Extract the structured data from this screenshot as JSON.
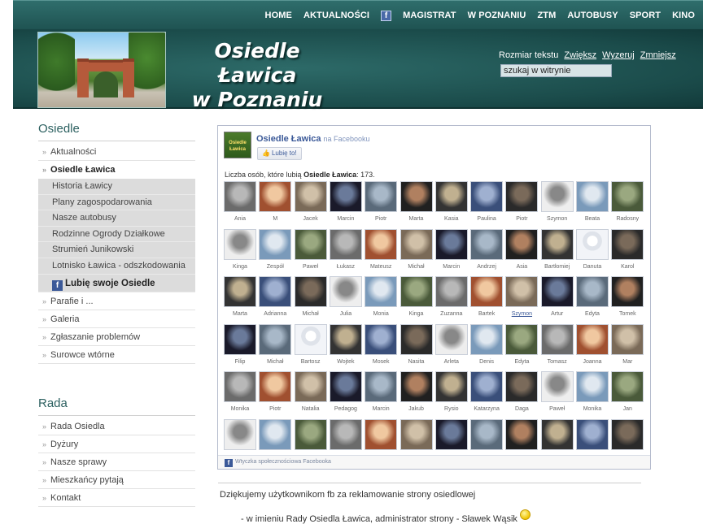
{
  "nav": {
    "items": [
      "HOME",
      "AKTUALNOŚCI",
      "f",
      "MAGISTRAT",
      "W POZNANIU",
      "ZTM",
      "AUTOBUSY",
      "SPORT",
      "KINO"
    ]
  },
  "header": {
    "title_line1": "Osiedle Ławica",
    "title_line2": "w Poznaniu",
    "text_size_label": "Rozmiar tekstu",
    "text_size_links": [
      "Zwiększ",
      "Wyzeruj",
      "Zmniejsz"
    ],
    "search_value": "szukaj w witrynie"
  },
  "sidebar": {
    "osiedle_heading": "Osiedle",
    "items_top": [
      "Aktualności",
      "Osiedle Ławica"
    ],
    "sub_items": [
      "Historia Ławicy",
      "Plany zagospodarowania",
      "Nasze autobusy",
      "Rodzinne Ogrody Działkowe",
      "Strumień Junikowski",
      "Lotnisko Ławica - odszkodowania"
    ],
    "fb_item": "Lubię swoje Osiedle",
    "items_bottom": [
      "Parafie i ...",
      "Galeria",
      "Zgłaszanie problemów",
      "Surowce wtórne"
    ],
    "rada_heading": "Rada",
    "rada_items": [
      "Rada Osiedla",
      "Dyżury",
      "Nasze sprawy",
      "Mieszkańcy pytają",
      "Kontakt"
    ]
  },
  "facebook": {
    "page_name": "Osiedle Ławica",
    "on_label": "na Facebooku",
    "like_label": "Lubię to!",
    "count_prefix": "Liczba osób, które lubią",
    "count_page": "Osiedle Ławica",
    "count_value": "173.",
    "fans": [
      "Ania",
      "M",
      "Jacek",
      "Marcin",
      "Piotr",
      "Marta",
      "Kasia",
      "Paulina",
      "Piotr",
      "Szymon",
      "Beata",
      "Radosny",
      "Kinga",
      "Zespół",
      "Paweł",
      "Łukasz",
      "Mateusz",
      "Michał",
      "Marcin",
      "Andrzej",
      "Asia",
      "Bartłomiej",
      "Danuta",
      "Karol",
      "Marta",
      "Adrianna",
      "Michał",
      "Julia",
      "Monia",
      "Kinga",
      "Zuzanna",
      "Bartek",
      "Szymon",
      "Artur",
      "Edyta",
      "Tomek",
      "Filip",
      "Michał",
      "Bartosz",
      "Wojtek",
      "Mosek",
      "Nasita",
      "Arleta",
      "Denis",
      "Edyta",
      "Tomasz",
      "Joanna",
      "Mar",
      "Monika",
      "Piotr",
      "Natalia",
      "Pedagog",
      "Marcin",
      "Jakub",
      "Rysio",
      "Katarzyna",
      "Daga",
      "Paweł",
      "Monika",
      "Jan",
      "",
      "",
      "",
      "",
      "",
      "",
      "",
      "",
      "",
      "",
      "",
      ""
    ],
    "plugin_label": "Wtyczka społecznościowa Facebooka"
  },
  "content": {
    "thanks": "Dziękujemy użytkownikom fb za reklamowanie strony osiedlowej",
    "signed": "- w imieniu Rady Osiedla Ławica, administrator strony - Sławek Wąsik"
  }
}
